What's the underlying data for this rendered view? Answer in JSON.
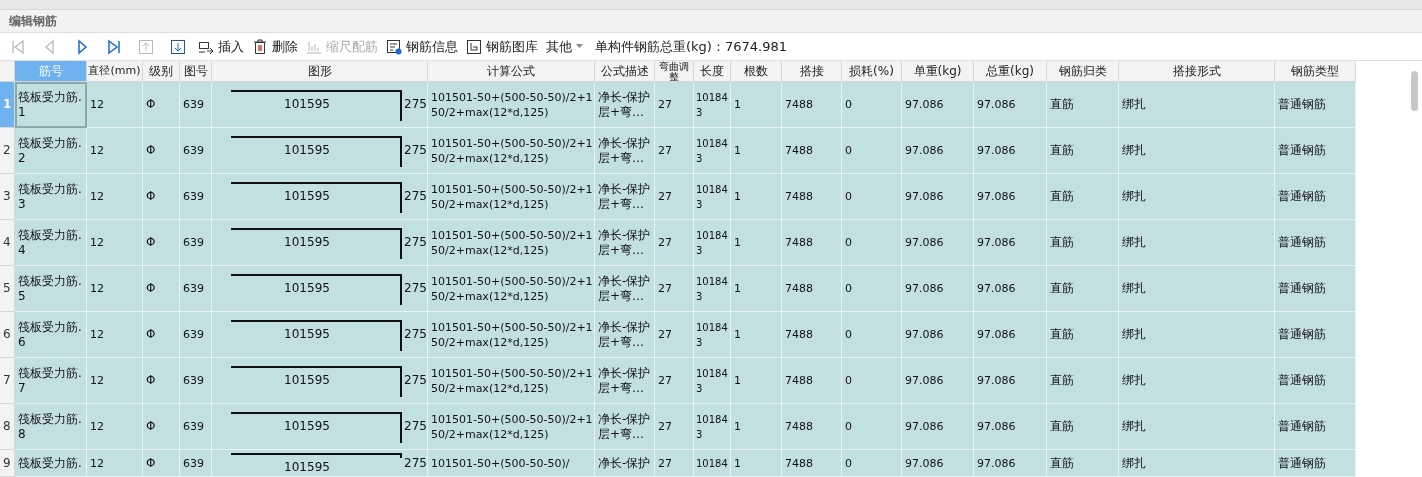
{
  "panel": {
    "title": "编辑钢筋"
  },
  "toolbar": {
    "buttons": [
      {
        "kind": "first",
        "disabled": true
      },
      {
        "kind": "prev",
        "disabled": true
      },
      {
        "kind": "next",
        "disabled": false
      },
      {
        "kind": "last",
        "disabled": false
      },
      {
        "kind": "up",
        "disabled": true
      },
      {
        "kind": "down",
        "disabled": false
      },
      {
        "kind": "insert",
        "label": "插入",
        "disabled": false
      },
      {
        "kind": "delete",
        "label": "删除",
        "disabled": false
      },
      {
        "kind": "scale",
        "label": "缩尺配筋",
        "disabled": true
      },
      {
        "kind": "info",
        "label": "钢筋信息",
        "disabled": false
      },
      {
        "kind": "library",
        "label": "钢筋图库",
        "disabled": false
      },
      {
        "kind": "dropdown",
        "label": "其他",
        "disabled": false
      }
    ],
    "total": "单构件钢筋总重(kg)：7674.981"
  },
  "table": {
    "columns": [
      "筋号",
      "直径(mm)",
      "级别",
      "图号",
      "图形",
      "计算公式",
      "公式描述",
      "弯曲调整",
      "长度",
      "根数",
      "搭接",
      "损耗(%)",
      "单重(kg)",
      "总重(kg)",
      "钢筋归类",
      "搭接形式",
      "钢筋类型"
    ],
    "rows": [
      {
        "number": "1",
        "selected": true,
        "name": "筏板受力筋.1",
        "diameter": "12",
        "grade": "Φ",
        "shape_no": "639",
        "shape_length": "101595",
        "shape_leg": "275",
        "formula": "101501-50+(500-50-50)/2+150/2+max(12*d,125)",
        "description": "净长-保护层+弯…",
        "bend": "27",
        "length": "101843",
        "count": "1",
        "lap": "7488",
        "loss": "0",
        "unit_weight": "97.086",
        "total_weight": "97.086",
        "category": "直筋",
        "lap_type": "绑扎",
        "rebar_type": "普通钢筋"
      },
      {
        "number": "2",
        "selected": false,
        "name": "筏板受力筋.2",
        "diameter": "12",
        "grade": "Φ",
        "shape_no": "639",
        "shape_length": "101595",
        "shape_leg": "275",
        "formula": "101501-50+(500-50-50)/2+150/2+max(12*d,125)",
        "description": "净长-保护层+弯…",
        "bend": "27",
        "length": "101843",
        "count": "1",
        "lap": "7488",
        "loss": "0",
        "unit_weight": "97.086",
        "total_weight": "97.086",
        "category": "直筋",
        "lap_type": "绑扎",
        "rebar_type": "普通钢筋"
      },
      {
        "number": "3",
        "selected": false,
        "name": "筏板受力筋.3",
        "diameter": "12",
        "grade": "Φ",
        "shape_no": "639",
        "shape_length": "101595",
        "shape_leg": "275",
        "formula": "101501-50+(500-50-50)/2+150/2+max(12*d,125)",
        "description": "净长-保护层+弯…",
        "bend": "27",
        "length": "101843",
        "count": "1",
        "lap": "7488",
        "loss": "0",
        "unit_weight": "97.086",
        "total_weight": "97.086",
        "category": "直筋",
        "lap_type": "绑扎",
        "rebar_type": "普通钢筋"
      },
      {
        "number": "4",
        "selected": false,
        "name": "筏板受力筋.4",
        "diameter": "12",
        "grade": "Φ",
        "shape_no": "639",
        "shape_length": "101595",
        "shape_leg": "275",
        "formula": "101501-50+(500-50-50)/2+150/2+max(12*d,125)",
        "description": "净长-保护层+弯…",
        "bend": "27",
        "length": "101843",
        "count": "1",
        "lap": "7488",
        "loss": "0",
        "unit_weight": "97.086",
        "total_weight": "97.086",
        "category": "直筋",
        "lap_type": "绑扎",
        "rebar_type": "普通钢筋"
      },
      {
        "number": "5",
        "selected": false,
        "name": "筏板受力筋.5",
        "diameter": "12",
        "grade": "Φ",
        "shape_no": "639",
        "shape_length": "101595",
        "shape_leg": "275",
        "formula": "101501-50+(500-50-50)/2+150/2+max(12*d,125)",
        "description": "净长-保护层+弯…",
        "bend": "27",
        "length": "101843",
        "count": "1",
        "lap": "7488",
        "loss": "0",
        "unit_weight": "97.086",
        "total_weight": "97.086",
        "category": "直筋",
        "lap_type": "绑扎",
        "rebar_type": "普通钢筋"
      },
      {
        "number": "6",
        "selected": false,
        "name": "筏板受力筋.6",
        "diameter": "12",
        "grade": "Φ",
        "shape_no": "639",
        "shape_length": "101595",
        "shape_leg": "275",
        "formula": "101501-50+(500-50-50)/2+150/2+max(12*d,125)",
        "description": "净长-保护层+弯…",
        "bend": "27",
        "length": "101843",
        "count": "1",
        "lap": "7488",
        "loss": "0",
        "unit_weight": "97.086",
        "total_weight": "97.086",
        "category": "直筋",
        "lap_type": "绑扎",
        "rebar_type": "普通钢筋"
      },
      {
        "number": "7",
        "selected": false,
        "name": "筏板受力筋.7",
        "diameter": "12",
        "grade": "Φ",
        "shape_no": "639",
        "shape_length": "101595",
        "shape_leg": "275",
        "formula": "101501-50+(500-50-50)/2+150/2+max(12*d,125)",
        "description": "净长-保护层+弯…",
        "bend": "27",
        "length": "101843",
        "count": "1",
        "lap": "7488",
        "loss": "0",
        "unit_weight": "97.086",
        "total_weight": "97.086",
        "category": "直筋",
        "lap_type": "绑扎",
        "rebar_type": "普通钢筋"
      },
      {
        "number": "8",
        "selected": false,
        "name": "筏板受力筋.8",
        "diameter": "12",
        "grade": "Φ",
        "shape_no": "639",
        "shape_length": "101595",
        "shape_leg": "275",
        "formula": "101501-50+(500-50-50)/2+150/2+max(12*d,125)",
        "description": "净长-保护层+弯…",
        "bend": "27",
        "length": "101843",
        "count": "1",
        "lap": "7488",
        "loss": "0",
        "unit_weight": "97.086",
        "total_weight": "97.086",
        "category": "直筋",
        "lap_type": "绑扎",
        "rebar_type": "普通钢筋"
      },
      {
        "number": "9",
        "selected": false,
        "name": "筏板受力筋.",
        "diameter": "12",
        "grade": "Φ",
        "shape_no": "639",
        "shape_length": "101595",
        "shape_leg": "275",
        "formula": "101501-50+(500-50-50)/",
        "description": "净长-保护",
        "bend": "27",
        "length": "10184",
        "count": "1",
        "lap": "7488",
        "loss": "0",
        "unit_weight": "97.086",
        "total_weight": "97.086",
        "category": "直筋",
        "lap_type": "绑扎",
        "rebar_type": "普通钢筋"
      }
    ]
  }
}
